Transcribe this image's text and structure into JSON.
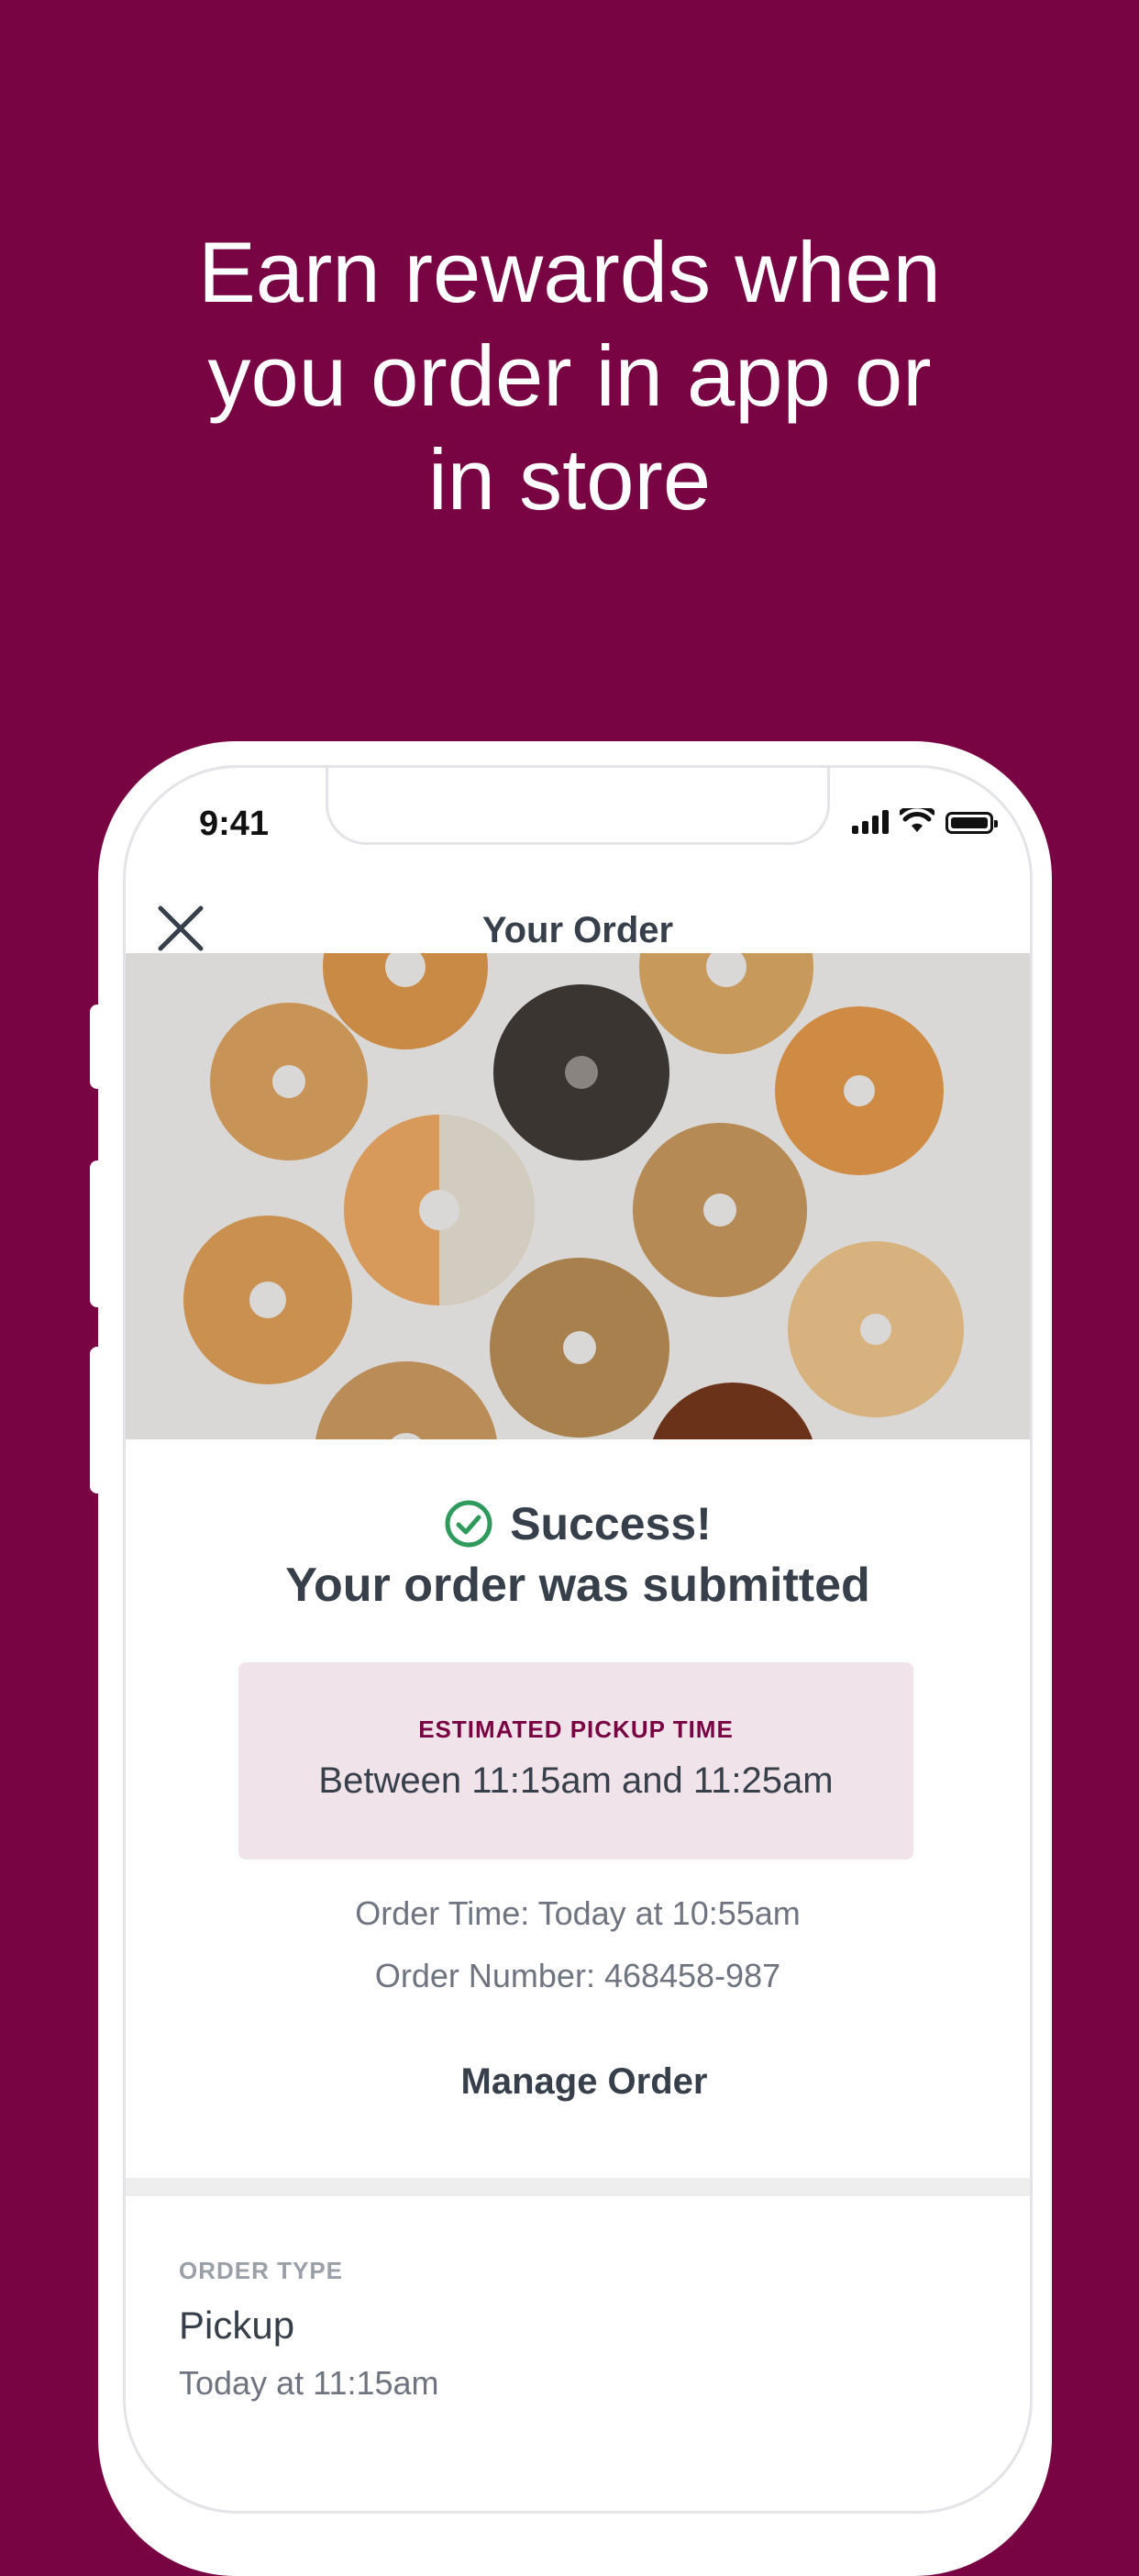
{
  "headline": {
    "line1": "Earn rewards when",
    "line2": "you order in app or",
    "line3": "in store"
  },
  "status_bar": {
    "time": "9:41"
  },
  "navbar": {
    "title": "Your Order"
  },
  "success": {
    "title": "Success!",
    "subtitle": "Your order was submitted"
  },
  "pickup": {
    "label": "ESTIMATED PICKUP TIME",
    "value": "Between 11:15am and 11:25am"
  },
  "order_info": {
    "time": "Order Time: Today at 10:55am",
    "number": "Order Number: 468458-987"
  },
  "manage_order_label": "Manage Order",
  "order_type": {
    "label": "ORDER TYPE",
    "value": "Pickup",
    "time": "Today at 11:15am"
  },
  "colors": {
    "brand": "#780443",
    "success_green": "#2e9a5c",
    "pickup_bg": "#f1e3ea",
    "text_dark": "#37404a"
  },
  "icons": [
    "close-icon",
    "check-circle-icon",
    "signal-icon",
    "wifi-icon",
    "battery-icon"
  ]
}
